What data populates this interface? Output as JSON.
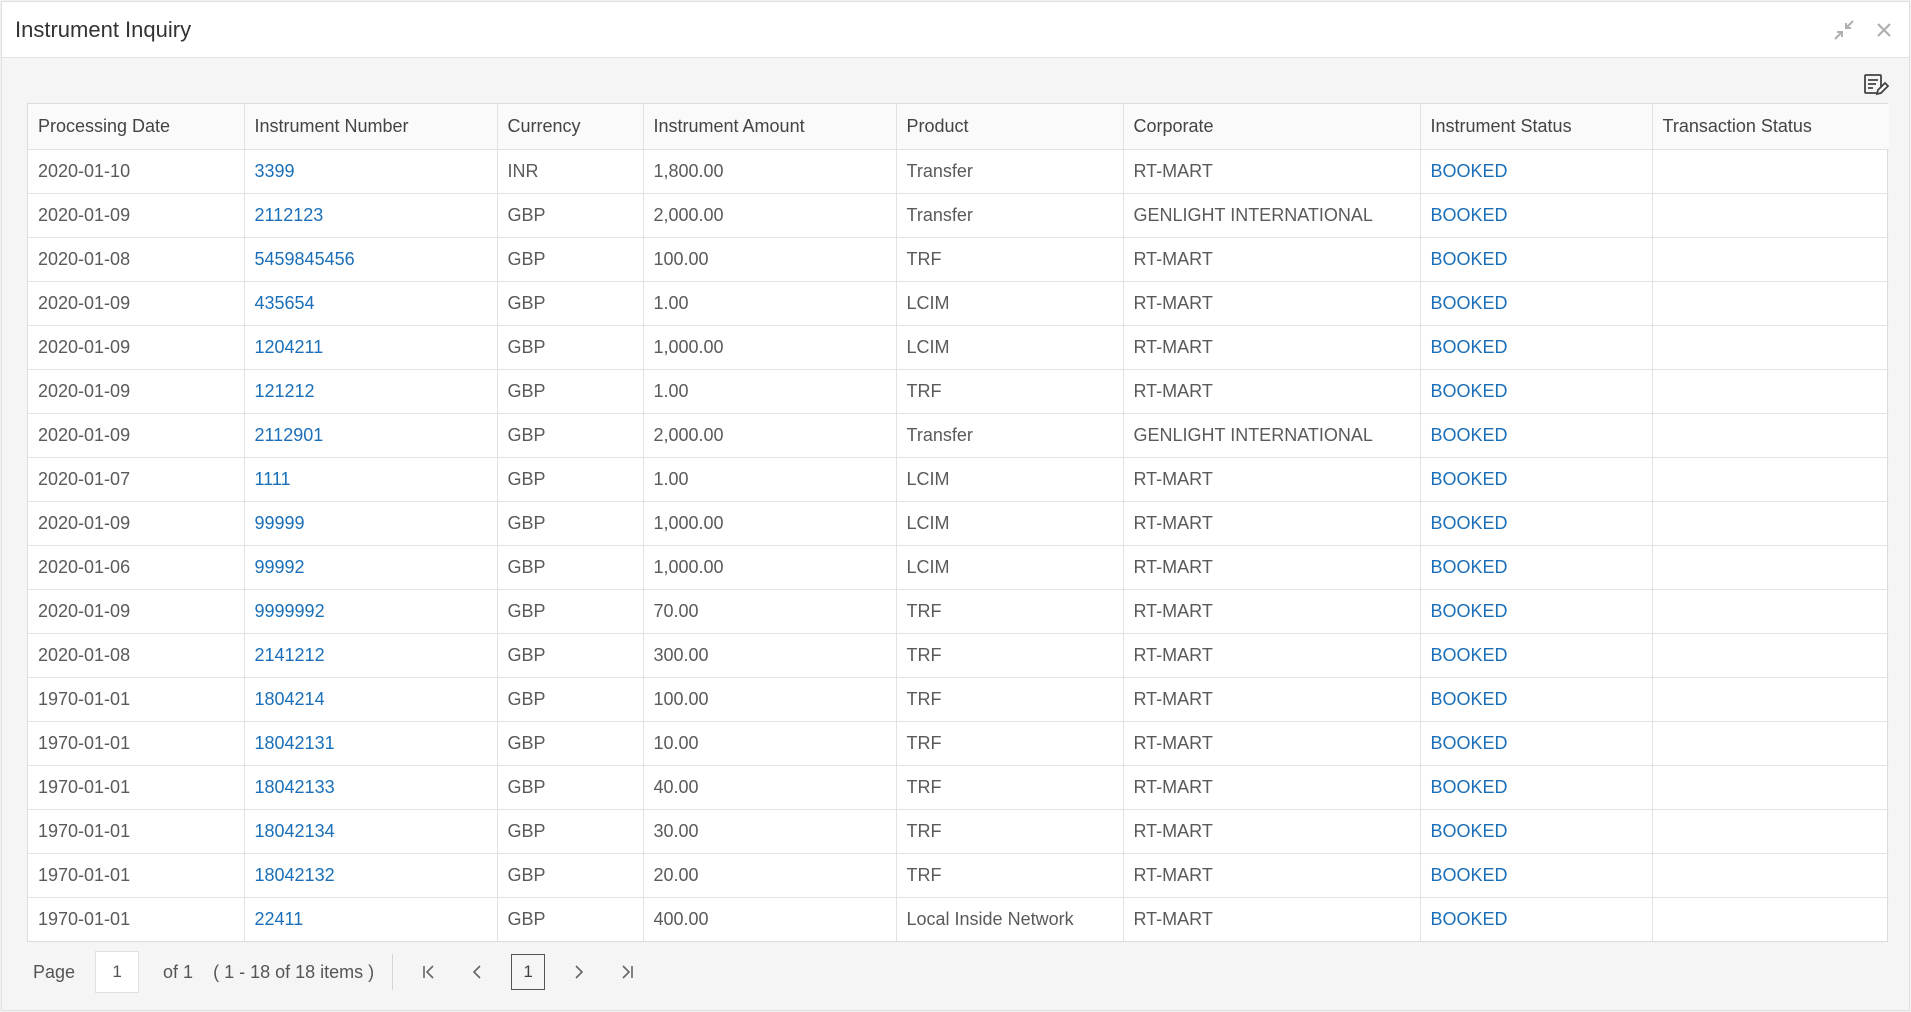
{
  "window": {
    "title": "Instrument Inquiry"
  },
  "icons": {
    "minimize": "collapse-arrows-icon",
    "close": "close-icon",
    "export": "edit-table-icon"
  },
  "table": {
    "columns": [
      "Processing Date",
      "Instrument Number",
      "Currency",
      "Instrument Amount",
      "Product",
      "Corporate",
      "Instrument Status",
      "Transaction Status"
    ],
    "rows": [
      [
        "2020-01-10",
        "3399",
        "INR",
        "1,800.00",
        "Transfer",
        "RT-MART",
        "BOOKED",
        ""
      ],
      [
        "2020-01-09",
        "2112123",
        "GBP",
        "2,000.00",
        "Transfer",
        "GENLIGHT INTERNATIONAL",
        "BOOKED",
        ""
      ],
      [
        "2020-01-08",
        "5459845456",
        "GBP",
        "100.00",
        "TRF",
        "RT-MART",
        "BOOKED",
        ""
      ],
      [
        "2020-01-09",
        "435654",
        "GBP",
        "1.00",
        "LCIM",
        "RT-MART",
        "BOOKED",
        ""
      ],
      [
        "2020-01-09",
        "1204211",
        "GBP",
        "1,000.00",
        "LCIM",
        "RT-MART",
        "BOOKED",
        ""
      ],
      [
        "2020-01-09",
        "121212",
        "GBP",
        "1.00",
        "TRF",
        "RT-MART",
        "BOOKED",
        ""
      ],
      [
        "2020-01-09",
        "2112901",
        "GBP",
        "2,000.00",
        "Transfer",
        "GENLIGHT INTERNATIONAL",
        "BOOKED",
        ""
      ],
      [
        "2020-01-07",
        "1111",
        "GBP",
        "1.00",
        "LCIM",
        "RT-MART",
        "BOOKED",
        ""
      ],
      [
        "2020-01-09",
        "99999",
        "GBP",
        "1,000.00",
        "LCIM",
        "RT-MART",
        "BOOKED",
        ""
      ],
      [
        "2020-01-06",
        "99992",
        "GBP",
        "1,000.00",
        "LCIM",
        "RT-MART",
        "BOOKED",
        ""
      ],
      [
        "2020-01-09",
        "9999992",
        "GBP",
        "70.00",
        "TRF",
        "RT-MART",
        "BOOKED",
        ""
      ],
      [
        "2020-01-08",
        "2141212",
        "GBP",
        "300.00",
        "TRF",
        "RT-MART",
        "BOOKED",
        ""
      ],
      [
        "1970-01-01",
        "1804214",
        "GBP",
        "100.00",
        "TRF",
        "RT-MART",
        "BOOKED",
        ""
      ],
      [
        "1970-01-01",
        "18042131",
        "GBP",
        "10.00",
        "TRF",
        "RT-MART",
        "BOOKED",
        ""
      ],
      [
        "1970-01-01",
        "18042133",
        "GBP",
        "40.00",
        "TRF",
        "RT-MART",
        "BOOKED",
        ""
      ],
      [
        "1970-01-01",
        "18042134",
        "GBP",
        "30.00",
        "TRF",
        "RT-MART",
        "BOOKED",
        ""
      ],
      [
        "1970-01-01",
        "18042132",
        "GBP",
        "20.00",
        "TRF",
        "RT-MART",
        "BOOKED",
        ""
      ],
      [
        "1970-01-01",
        "22411",
        "GBP",
        "400.00",
        "Local Inside Network",
        "RT-MART",
        "BOOKED",
        ""
      ]
    ]
  },
  "pager": {
    "page_label": "Page",
    "current_page": "1",
    "of_label": "of 1",
    "items_info": "( 1 - 18 of 18 items )",
    "page_button": "1"
  },
  "colors": {
    "link": "#1a6fb8",
    "text": "#5a5a5a"
  }
}
